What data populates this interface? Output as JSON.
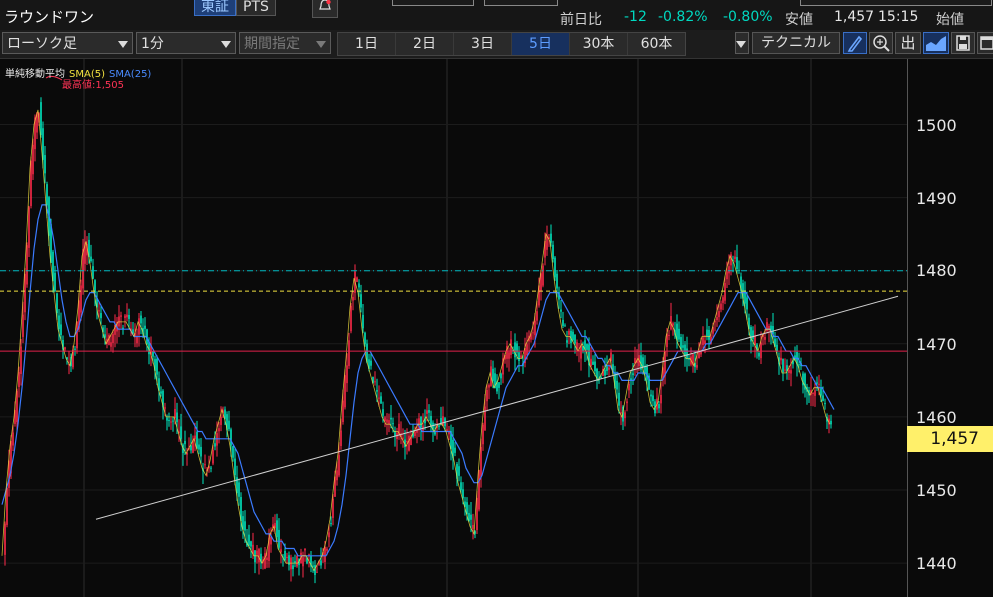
{
  "stock": {
    "name": "ラウンドワン"
  },
  "market_tabs": [
    "東証",
    "PTS"
  ],
  "quote": {
    "change_label": "前日比",
    "change": "-12",
    "change_pct": "-0.82%",
    "change_pct2": "-0.80%",
    "low_label": "安値",
    "low": "1,457",
    "time": "15:15",
    "open_label": "始値"
  },
  "toolbar": {
    "chart_type": "ローソク足",
    "interval": "1分",
    "range_select": "期間指定",
    "periods": [
      "1日",
      "2日",
      "3日",
      "5日",
      "30本",
      "60本"
    ],
    "active_period": "5日",
    "technical": "テクニカル",
    "icons": [
      "pencil-icon",
      "zoom-icon",
      "volume-icon",
      "chart-type-icon",
      "save-icon",
      "window-icon"
    ],
    "volume_label": "出"
  },
  "legend": {
    "title": "単純移動平均",
    "sma5": "SMA(5)",
    "sma25": "SMA(25)",
    "high_label": "最高値:1,505"
  },
  "colors": {
    "up": "#ff2a4a",
    "down": "#00e8c0",
    "sma5": "#f0e040",
    "sma25": "#3b7bff",
    "accent": "#1e3f78",
    "price_tag": "#fff06a"
  },
  "y_axis": {
    "ticks": [
      1500,
      1490,
      1480,
      1470,
      1460,
      1450,
      1440
    ]
  },
  "current_price": "1,457",
  "chart_data": {
    "type": "line",
    "title": "",
    "xlabel": "",
    "ylabel": "",
    "ylim": [
      1434.5,
      1510.5
    ],
    "grid": true,
    "x": [
      0,
      4,
      8,
      12,
      16,
      20,
      24,
      28,
      32,
      36,
      40,
      44,
      48,
      52,
      56,
      60,
      64,
      68,
      72,
      76,
      80,
      84,
      88,
      92,
      96,
      100,
      104,
      108,
      112,
      116,
      120,
      124,
      128,
      132,
      136,
      140,
      144,
      148,
      152,
      156,
      160,
      164,
      168,
      172,
      176,
      180,
      184,
      188,
      192,
      196,
      200,
      204,
      208,
      212,
      216,
      220,
      224,
      228,
      232,
      236,
      240,
      244,
      248,
      252,
      256,
      260,
      264,
      268,
      272,
      276,
      280,
      284,
      288,
      292,
      296,
      300,
      304,
      308,
      312,
      316,
      320,
      324,
      328,
      332,
      336,
      340,
      344,
      348,
      352,
      356,
      360,
      364,
      368,
      372,
      376,
      380,
      384,
      388,
      392,
      396,
      400,
      404,
      408,
      412,
      416,
      420,
      424,
      428,
      432,
      436,
      440,
      444,
      448,
      452,
      456,
      460,
      464,
      468,
      472,
      476,
      480,
      484,
      488,
      492,
      496,
      500,
      504,
      508,
      512,
      516,
      520,
      524,
      528,
      532,
      536,
      540,
      544,
      548,
      552,
      556,
      560,
      564,
      568,
      572,
      576,
      580,
      584,
      588,
      592,
      596,
      600,
      604,
      608,
      612,
      616,
      620,
      624,
      628,
      632,
      636,
      640,
      644,
      648,
      652,
      656,
      660,
      664,
      668,
      672,
      676,
      680,
      684,
      688,
      692,
      696,
      700,
      704,
      708,
      712,
      716,
      720,
      724,
      728,
      732,
      736,
      740,
      744,
      748,
      752,
      756,
      760,
      764,
      768,
      772,
      776,
      780,
      784,
      788,
      792,
      796,
      800,
      804,
      808,
      812,
      816,
      820,
      824,
      828,
      832,
      836,
      840,
      844,
      848,
      852,
      856,
      860,
      864,
      868,
      872,
      876,
      880,
      884,
      888,
      892,
      896,
      900,
      904
    ],
    "series": [
      {
        "name": "SMA(5)",
        "values": [
          1441,
          1450,
          1456,
          1460,
          1466,
          1474,
          1483,
          1494,
          1500,
          1502,
          1496,
          1489,
          1482,
          1477,
          1472,
          1470,
          1468,
          1467,
          1470,
          1475,
          1482,
          1484,
          1481,
          1477,
          1474,
          1472,
          1470,
          1471,
          1472,
          1473,
          1473,
          1473,
          1472,
          1471,
          1473,
          1472,
          1470,
          1469,
          1467,
          1464,
          1462,
          1460,
          1460,
          1460,
          1458,
          1456,
          1455,
          1456,
          1457,
          1455,
          1453,
          1452,
          1454,
          1457,
          1459,
          1461,
          1459,
          1456,
          1452,
          1448,
          1445,
          1443,
          1442,
          1441,
          1441,
          1440,
          1441,
          1444,
          1445,
          1442,
          1441,
          1440,
          1440,
          1440,
          1440,
          1441,
          1441,
          1440,
          1439,
          1440,
          1441,
          1443,
          1446,
          1451,
          1455,
          1462,
          1468,
          1475,
          1479,
          1477,
          1472,
          1468,
          1466,
          1464,
          1462,
          1460,
          1459,
          1459,
          1458,
          1458,
          1457,
          1456,
          1457,
          1458,
          1459,
          1459,
          1460,
          1459,
          1458,
          1459,
          1459,
          1458,
          1456,
          1454,
          1451,
          1449,
          1447,
          1445,
          1444,
          1452,
          1459,
          1464,
          1466,
          1464,
          1465,
          1467,
          1469,
          1470,
          1469,
          1468,
          1468,
          1470,
          1471,
          1473,
          1477,
          1481,
          1485,
          1484,
          1479,
          1475,
          1472,
          1471,
          1471,
          1470,
          1469,
          1470,
          1469,
          1467,
          1466,
          1465,
          1466,
          1467,
          1468,
          1465,
          1461,
          1460,
          1463,
          1466,
          1467,
          1468,
          1467,
          1465,
          1462,
          1461,
          1462,
          1466,
          1471,
          1473,
          1472,
          1470,
          1469,
          1468,
          1468,
          1467,
          1469,
          1471,
          1471,
          1471,
          1473,
          1475,
          1477,
          1480,
          1482,
          1481,
          1479,
          1477,
          1474,
          1471,
          1470,
          1469,
          1471,
          1472,
          1472,
          1470,
          1468,
          1466,
          1466,
          1467,
          1468,
          1467,
          1465,
          1464,
          1463,
          1464,
          1464,
          1462,
          1460,
          1459
        ]
      },
      {
        "name": "SMA(25)",
        "values": [
          1448,
          1450,
          1452,
          1455,
          1459,
          1464,
          1470,
          1477,
          1483,
          1487,
          1489,
          1489,
          1487,
          1484,
          1480,
          1476,
          1473,
          1471,
          1471,
          1472,
          1474,
          1476,
          1477,
          1477,
          1476,
          1475,
          1474,
          1473,
          1473,
          1472,
          1472,
          1472,
          1472,
          1471,
          1471,
          1471,
          1471,
          1470,
          1469,
          1468,
          1467,
          1466,
          1465,
          1464,
          1463,
          1462,
          1461,
          1460,
          1459,
          1458,
          1458,
          1457,
          1457,
          1457,
          1457,
          1457,
          1457,
          1457,
          1456,
          1455,
          1453,
          1451,
          1449,
          1447,
          1446,
          1445,
          1444,
          1444,
          1443,
          1443,
          1443,
          1442,
          1442,
          1442,
          1441,
          1441,
          1441,
          1441,
          1441,
          1441,
          1441,
          1441,
          1442,
          1443,
          1445,
          1448,
          1452,
          1457,
          1462,
          1466,
          1468,
          1469,
          1469,
          1468,
          1467,
          1466,
          1465,
          1464,
          1463,
          1462,
          1461,
          1460,
          1459,
          1459,
          1459,
          1458,
          1458,
          1458,
          1458,
          1458,
          1458,
          1458,
          1458,
          1457,
          1456,
          1455,
          1453,
          1452,
          1451,
          1451,
          1452,
          1454,
          1456,
          1458,
          1460,
          1462,
          1464,
          1465,
          1466,
          1467,
          1467,
          1468,
          1469,
          1470,
          1472,
          1474,
          1476,
          1477,
          1477,
          1477,
          1476,
          1475,
          1474,
          1473,
          1472,
          1471,
          1471,
          1470,
          1469,
          1468,
          1468,
          1467,
          1467,
          1466,
          1466,
          1465,
          1465,
          1465,
          1465,
          1466,
          1466,
          1466,
          1465,
          1465,
          1465,
          1465,
          1466,
          1467,
          1468,
          1469,
          1469,
          1469,
          1469,
          1469,
          1469,
          1469,
          1470,
          1470,
          1471,
          1472,
          1473,
          1474,
          1475,
          1476,
          1477,
          1477,
          1477,
          1476,
          1475,
          1474,
          1473,
          1472,
          1472,
          1471,
          1471,
          1470,
          1469,
          1469,
          1468,
          1468,
          1467,
          1467,
          1466,
          1465,
          1464,
          1464,
          1463,
          1462,
          1461
        ]
      }
    ],
    "horizontal_lines": [
      {
        "price": 1480,
        "style": "dash-dot",
        "color": "#00b8c0"
      },
      {
        "price": 1477.2,
        "style": "dashed",
        "color": "#f0e040"
      },
      {
        "price": 1469,
        "style": "solid",
        "color": "#e0204a"
      }
    ],
    "trendline": {
      "from": {
        "x": 96,
        "price": 1446
      },
      "to": {
        "x": 898,
        "price": 1476.5
      },
      "color": "#d0d0d0"
    },
    "vertical_separators": [
      84,
      182,
      447,
      638,
      811
    ]
  }
}
